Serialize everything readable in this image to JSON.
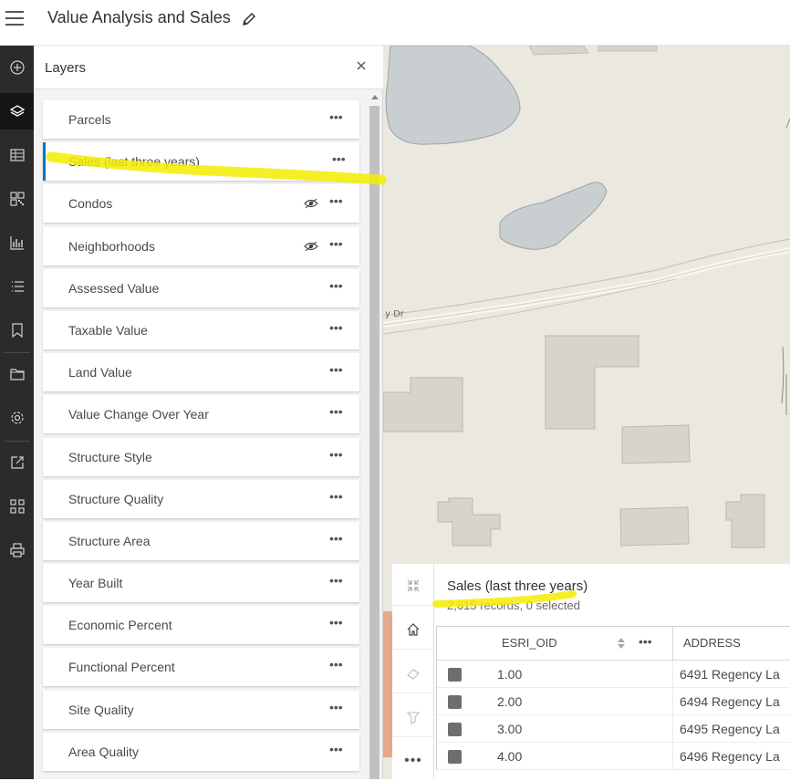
{
  "header": {
    "title": "Value Analysis and Sales"
  },
  "rail": {
    "icons": [
      "add-icon",
      "layers-icon",
      "table-icon",
      "qr-icon",
      "chart-icon",
      "list-icon",
      "bookmark-icon",
      "folder-icon",
      "settings-icon",
      "share-icon",
      "apps-icon",
      "print-icon"
    ]
  },
  "layers_panel": {
    "title": "Layers",
    "items": [
      {
        "label": "Parcels",
        "eye": false,
        "selected": false
      },
      {
        "label": "Sales (last three years)",
        "eye": false,
        "selected": true
      },
      {
        "label": "Condos",
        "eye": true,
        "selected": false
      },
      {
        "label": "Neighborhoods",
        "eye": true,
        "selected": false
      },
      {
        "label": "Assessed Value",
        "eye": false,
        "selected": false
      },
      {
        "label": "Taxable Value",
        "eye": false,
        "selected": false
      },
      {
        "label": "Land Value",
        "eye": false,
        "selected": false
      },
      {
        "label": "Value Change Over Year",
        "eye": false,
        "selected": false
      },
      {
        "label": "Structure Style",
        "eye": false,
        "selected": false
      },
      {
        "label": "Structure Quality",
        "eye": false,
        "selected": false
      },
      {
        "label": "Structure Area",
        "eye": false,
        "selected": false
      },
      {
        "label": "Year Built",
        "eye": false,
        "selected": false
      },
      {
        "label": "Economic Percent",
        "eye": false,
        "selected": false
      },
      {
        "label": "Functional Percent",
        "eye": false,
        "selected": false
      },
      {
        "label": "Site Quality",
        "eye": false,
        "selected": false
      },
      {
        "label": "Area Quality",
        "eye": false,
        "selected": false
      }
    ],
    "more_glyph": "•••"
  },
  "map": {
    "road_label": "y Dr",
    "colors": {
      "background": "#ebe8e0",
      "water": "#c9cfd1",
      "building": "#d8d3cc"
    }
  },
  "tools": {
    "more_glyph": "•••"
  },
  "table": {
    "title": "Sales (last three years)",
    "subtitle": "2,615 records, 0 selected",
    "columns": {
      "oid": "ESRI_OID",
      "address": "ADDRESS"
    },
    "more_glyph": "•••",
    "rows": [
      {
        "oid": "1.00",
        "address": "6491 Regency La"
      },
      {
        "oid": "2.00",
        "address": "6494 Regency La"
      },
      {
        "oid": "3.00",
        "address": "6495 Regency La"
      },
      {
        "oid": "4.00",
        "address": "6496 Regency La"
      }
    ]
  },
  "annotations": {
    "highlight_color": "#f5ec00"
  }
}
